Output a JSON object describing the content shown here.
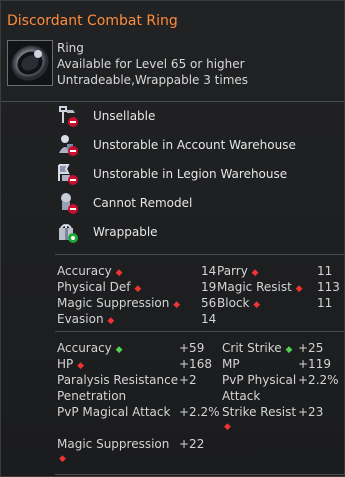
{
  "item": {
    "name": "Discordant Combat Ring",
    "type": "Ring",
    "level_req": "Available for Level 65 or higher",
    "trade_info": "Untradeable,Wrappable 3 times"
  },
  "restrictions": [
    {
      "label": "Unsellable",
      "icon": "unsellable-icon"
    },
    {
      "label": "Unstorable in Account Warehouse",
      "icon": "account-warehouse-icon"
    },
    {
      "label": "Unstorable in Legion Warehouse",
      "icon": "legion-warehouse-icon"
    },
    {
      "label": "Cannot Remodel",
      "icon": "remodel-icon"
    },
    {
      "label": "Wrappable",
      "icon": "wrap-icon"
    }
  ],
  "base_stats": [
    {
      "label": "Accuracy",
      "value": "14",
      "label2": "Parry",
      "value2": "11"
    },
    {
      "label": "Physical Def",
      "value": "19",
      "label2": "Magic Resist",
      "value2": "113"
    },
    {
      "label": "Magic Suppression",
      "value": "56",
      "label2": "Block",
      "value2": "11"
    },
    {
      "label": "Evasion",
      "value": "14",
      "label2": "",
      "value2": ""
    }
  ],
  "bonus_stats": {
    "accuracy": {
      "label": "Accuracy",
      "value": "+59"
    },
    "crit": {
      "label": "Crit Strike",
      "value": "+25"
    },
    "hp": {
      "label": "HP",
      "value": "+168"
    },
    "mp": {
      "label": "MP",
      "value": "+119"
    },
    "paralysis": {
      "label": "Paralysis Resistance Penetration",
      "label_line1": "Paralysis Resistance",
      "label_line2": "Penetration",
      "value": "+2"
    },
    "pvp_phys": {
      "label": "PvP Physical Attack",
      "label_line1": "PvP Physical",
      "label_line2": "Attack",
      "value": "+2.2%"
    },
    "pvp_mag": {
      "label": "PvP Magical Attack",
      "value": "+2.2%"
    },
    "strike_resist": {
      "label": "Strike Resist",
      "value": "+23"
    },
    "magic_supp": {
      "label": "Magic Suppression",
      "value": "+22"
    }
  },
  "colors": {
    "title": "#ff8c3a",
    "down_arrow": "#e33333",
    "up_arrow": "#4fd24f"
  }
}
